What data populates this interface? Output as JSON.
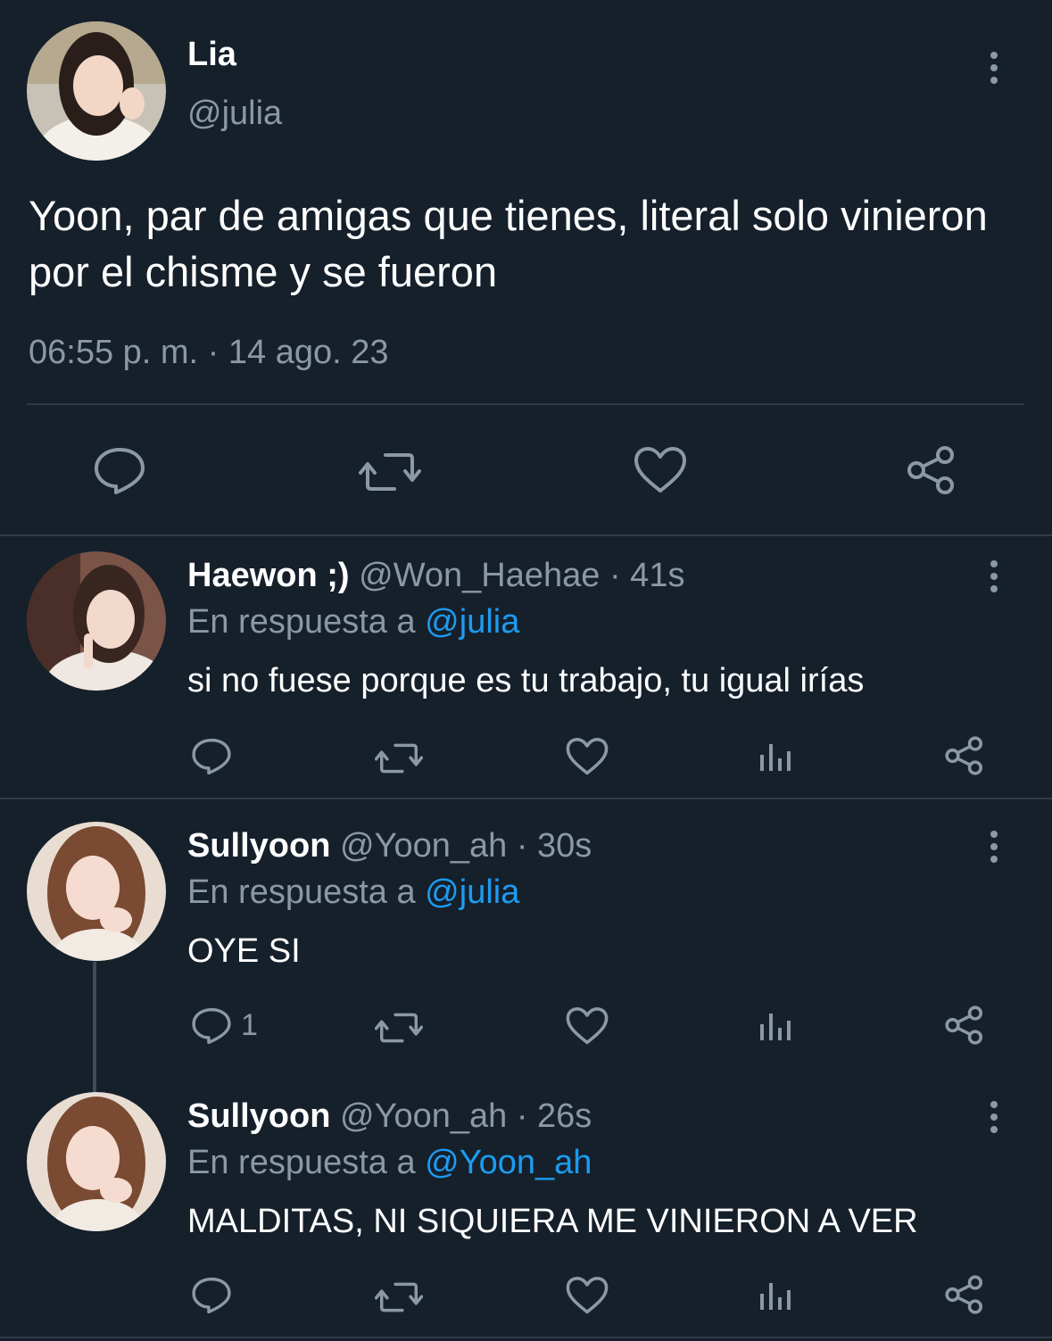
{
  "main_tweet": {
    "name": "Lia",
    "handle": "@julia",
    "text": "Yoon, par de amigas que tienes, literal solo vinieron por el chisme y se fueron",
    "time_date": "06:55 p. m. · 14 ago. 23"
  },
  "replies": [
    {
      "name": "Haewon ;)",
      "handle": "@Won_Haehae",
      "time": "· 41s",
      "replying_prefix": "En respuesta a",
      "replying_to": "@julia",
      "text": "si no fuese porque es tu trabajo, tu igual irías",
      "reply_count": ""
    },
    {
      "name": "Sullyoon",
      "handle": "@Yoon_ah",
      "time": "· 30s",
      "replying_prefix": "En respuesta a",
      "replying_to": "@julia",
      "text": "OYE SI",
      "reply_count": "1"
    },
    {
      "name": "Sullyoon",
      "handle": "@Yoon_ah",
      "time": "· 26s",
      "replying_prefix": "En respuesta a",
      "replying_to": "@Yoon_ah",
      "text": "MALDITAS, NI SIQUIERA ME VINIERON A VER",
      "reply_count": ""
    }
  ],
  "colors": {
    "background": "#15202b",
    "text": "#ffffff",
    "muted": "#8b98a5",
    "link": "#1d9bf0",
    "divider": "#2f3b47"
  },
  "icons": [
    "comment-icon",
    "retweet-icon",
    "like-icon",
    "share-icon",
    "views-icon",
    "more-icon"
  ]
}
